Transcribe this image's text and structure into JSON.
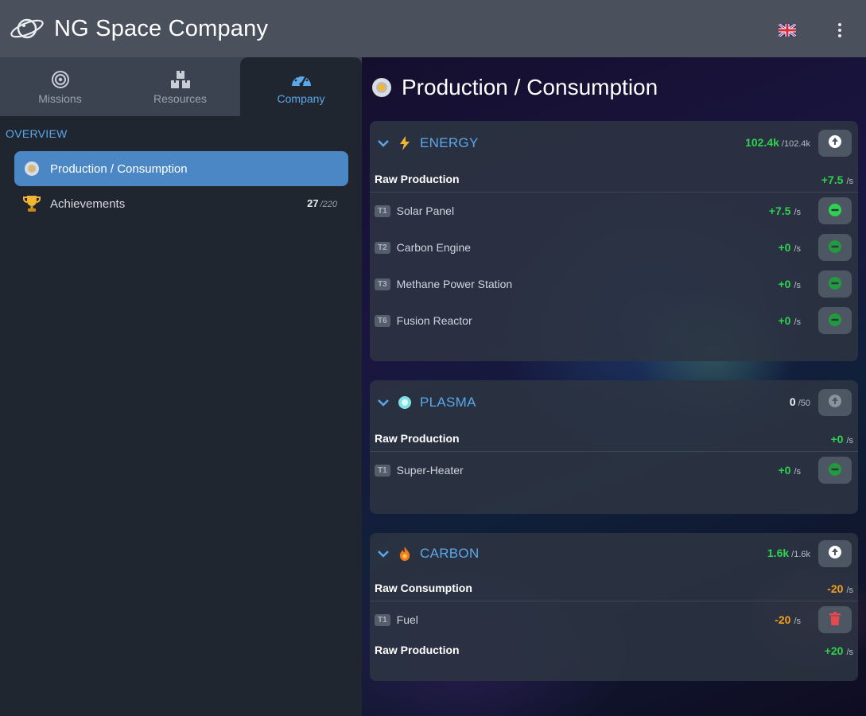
{
  "app": {
    "title": "NG Space Company"
  },
  "colors": {
    "accent": "#5aa8ea",
    "positive": "#2fd14f",
    "warning": "#f0a020",
    "danger": "#e5484d",
    "active_nav": "#4b87c4"
  },
  "tabs": [
    {
      "label": "Missions",
      "icon": "target-icon"
    },
    {
      "label": "Resources",
      "icon": "boxes-icon"
    },
    {
      "label": "Company",
      "icon": "speedometer-icon",
      "active": true
    }
  ],
  "sidebar": {
    "section_title": "OVERVIEW",
    "items": [
      {
        "label": "Production / Consumption",
        "icon": "gear-icon",
        "active": true
      },
      {
        "label": "Achievements",
        "icon": "trophy-icon",
        "count": "27",
        "total": "/220"
      }
    ]
  },
  "main": {
    "title": "Production / Consumption",
    "resources": [
      {
        "name": "ENERGY",
        "icon": "lightning-icon",
        "amount": "102.4k",
        "capacity": "/102.4k",
        "button_icon": "arrow-up-icon",
        "summary_label": "Raw Production",
        "summary_rate": "+7.5",
        "unit": "/s",
        "rows": [
          {
            "tier": "T1",
            "name": "Solar Panel",
            "rate": "+7.5",
            "unit": "/s",
            "button_icon": "minus-circle-icon"
          },
          {
            "tier": "T2",
            "name": "Carbon Engine",
            "rate": "+0",
            "unit": "/s",
            "button_icon": "minus-circle-icon"
          },
          {
            "tier": "T3",
            "name": "Methane Power Station",
            "rate": "+0",
            "unit": "/s",
            "button_icon": "minus-circle-icon"
          },
          {
            "tier": "T6",
            "name": "Fusion Reactor",
            "rate": "+0",
            "unit": "/s",
            "button_icon": "minus-circle-icon"
          }
        ]
      },
      {
        "name": "PLASMA",
        "icon": "plasma-orb-icon",
        "amount": "0",
        "capacity": "/50",
        "button_icon": "arrow-up-icon",
        "summary_label": "Raw Production",
        "summary_rate": "+0",
        "unit": "/s",
        "rows": [
          {
            "tier": "T1",
            "name": "Super-Heater",
            "rate": "+0",
            "unit": "/s",
            "button_icon": "minus-circle-icon"
          }
        ]
      },
      {
        "name": "CARBON",
        "icon": "flame-icon",
        "amount": "1.6k",
        "capacity": "/1.6k",
        "button_icon": "arrow-up-icon",
        "consumption_label": "Raw Consumption",
        "consumption_rate": "-20",
        "unit": "/s",
        "rows": [
          {
            "tier": "T1",
            "name": "Fuel",
            "rate": "-20",
            "unit": "/s",
            "button_icon": "trash-icon"
          }
        ],
        "summary_label": "Raw Production",
        "summary_rate": "+20"
      }
    ]
  }
}
